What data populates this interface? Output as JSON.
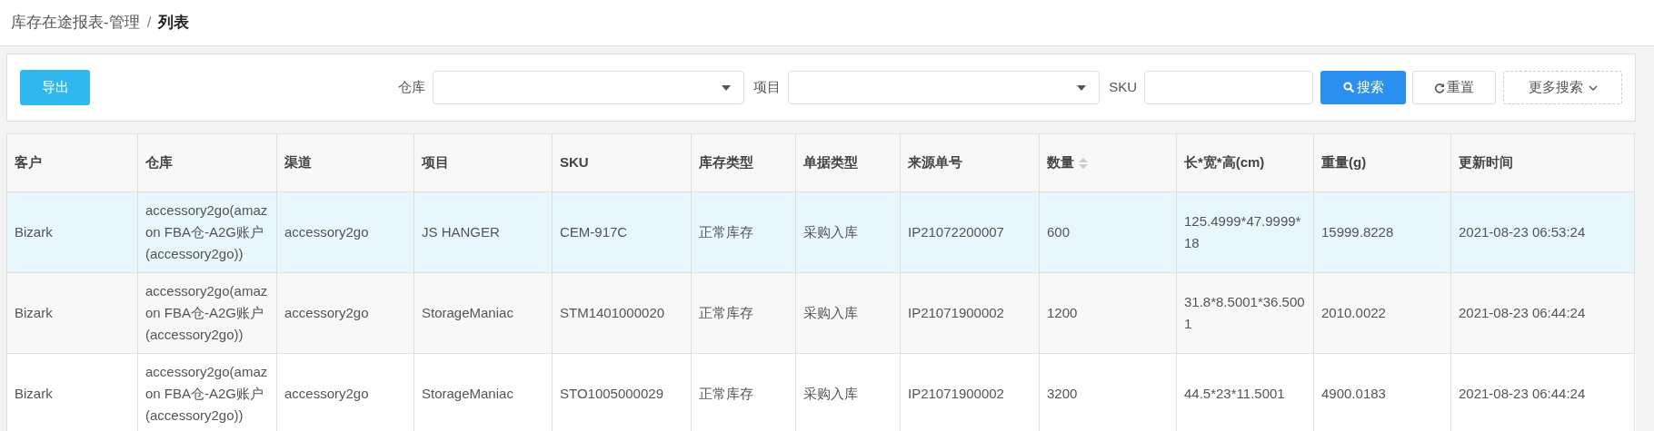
{
  "breadcrumb": {
    "separator": "/",
    "items": [
      {
        "label": "库存在途报表-管理",
        "current": false
      },
      {
        "label": "列表",
        "current": true
      }
    ]
  },
  "toolbar": {
    "export_button": "导出",
    "filters": [
      {
        "kind": "select",
        "label": "仓库"
      },
      {
        "kind": "select",
        "label": "项目"
      },
      {
        "kind": "input",
        "label": "SKU"
      }
    ],
    "search_button": "搜索",
    "reset_button": "重置",
    "more_button": "更多搜索"
  },
  "table": {
    "columns": [
      {
        "label": "客户",
        "sortable": false
      },
      {
        "label": "仓库",
        "sortable": false
      },
      {
        "label": "渠道",
        "sortable": false
      },
      {
        "label": "项目",
        "sortable": false
      },
      {
        "label": "SKU",
        "sortable": false
      },
      {
        "label": "库存类型",
        "sortable": false
      },
      {
        "label": "单据类型",
        "sortable": false
      },
      {
        "label": "来源单号",
        "sortable": false
      },
      {
        "label": "数量",
        "sortable": true
      },
      {
        "label": "长*宽*高(cm)",
        "sortable": false
      },
      {
        "label": "重量(g)",
        "sortable": false
      },
      {
        "label": "更新时间",
        "sortable": false
      }
    ],
    "rows": [
      {
        "selected": true,
        "cells": [
          "Bizark",
          "accessory2go(amazon FBA仓-A2G账户(accessory2go))",
          "accessory2go",
          "JS HANGER",
          "CEM-917C",
          "正常库存",
          "采购入库",
          "IP21072200007",
          "600",
          "125.4999*47.9999*18",
          "15999.8228",
          "2021-08-23 06:53:24"
        ]
      },
      {
        "selected": false,
        "cells": [
          "Bizark",
          "accessory2go(amazon FBA仓-A2G账户(accessory2go))",
          "accessory2go",
          "StorageManiac",
          "STM1401000020",
          "正常库存",
          "采购入库",
          "IP21071900002",
          "1200",
          "31.8*8.5001*36.5001",
          "2010.0022",
          "2021-08-23 06:44:24"
        ]
      },
      {
        "selected": false,
        "cells": [
          "Bizark",
          "accessory2go(amazon FBA仓-A2G账户(accessory2go))",
          "accessory2go",
          "StorageManiac",
          "STO1005000029",
          "正常库存",
          "采购入库",
          "IP21071900002",
          "3200",
          "44.5*23*11.5001",
          "4900.0183",
          "2021-08-23 06:44:24"
        ]
      }
    ]
  }
}
